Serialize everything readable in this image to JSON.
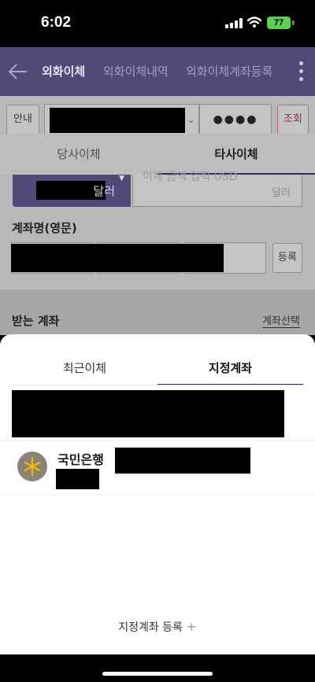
{
  "status_bar": {
    "time": "6:02",
    "battery": "77"
  },
  "nav": {
    "tabs": [
      {
        "label": "외화이체"
      },
      {
        "label": "외화이체내역"
      },
      {
        "label": "외화이체계좌등록"
      }
    ]
  },
  "account_row": {
    "info_label": "안내",
    "password_mask": "●●●●",
    "query_label": "조회"
  },
  "subtabs": [
    {
      "label": "당사이체"
    },
    {
      "label": "타사이체"
    }
  ],
  "amount": {
    "currency_unit": "달러",
    "placeholder": "이체 금액 입력 USD",
    "amount_unit": "달러"
  },
  "name_section": {
    "label": "계좌명(영문)",
    "register_label": "등록"
  },
  "receive_section": {
    "label": "받는 계좌",
    "select_label": "계좌선택"
  },
  "sheet": {
    "tabs": [
      {
        "label": "최근이체"
      },
      {
        "label": "지정계좌"
      }
    ],
    "items": [
      {
        "bank": "국민은행"
      }
    ],
    "register_label": "지정계좌 등록",
    "register_plus": "+"
  }
}
